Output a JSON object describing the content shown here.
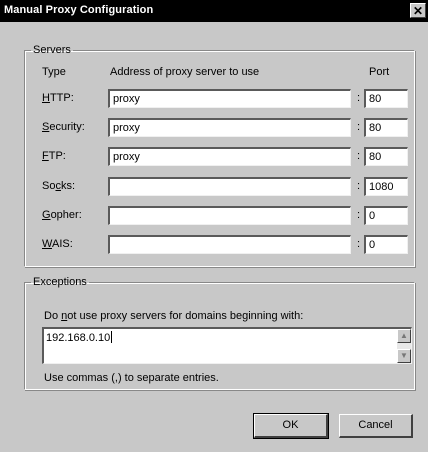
{
  "window": {
    "title": "Manual Proxy Configuration",
    "close_glyph": "✕"
  },
  "servers": {
    "legend": "Servers",
    "col_type": "Type",
    "col_address": "Address of proxy server to use",
    "col_port": "Port",
    "rows": [
      {
        "label_ul": "H",
        "label_rest": "TTP:",
        "address": "proxy",
        "port": "80"
      },
      {
        "label_ul": "S",
        "label_rest": "ecurity:",
        "address": "proxy",
        "port": "80"
      },
      {
        "label_ul": "F",
        "label_rest": "TP:",
        "address": "proxy",
        "port": "80"
      },
      {
        "label_pre": "So",
        "label_ul": "c",
        "label_rest": "ks:",
        "address": "",
        "port": "1080"
      },
      {
        "label_ul": "G",
        "label_rest": "opher:",
        "address": "",
        "port": "0"
      },
      {
        "label_ul": "W",
        "label_rest": "AIS:",
        "address": "",
        "port": "0"
      }
    ],
    "separator": ":"
  },
  "exceptions": {
    "legend": "Exceptions",
    "desc_pre": "Do ",
    "desc_ul": "n",
    "desc_rest": "ot use proxy servers for domains beginning with:",
    "value": "192.168.0.10",
    "hint": "Use commas (,) to separate entries."
  },
  "buttons": {
    "ok": "OK",
    "cancel": "Cancel"
  }
}
